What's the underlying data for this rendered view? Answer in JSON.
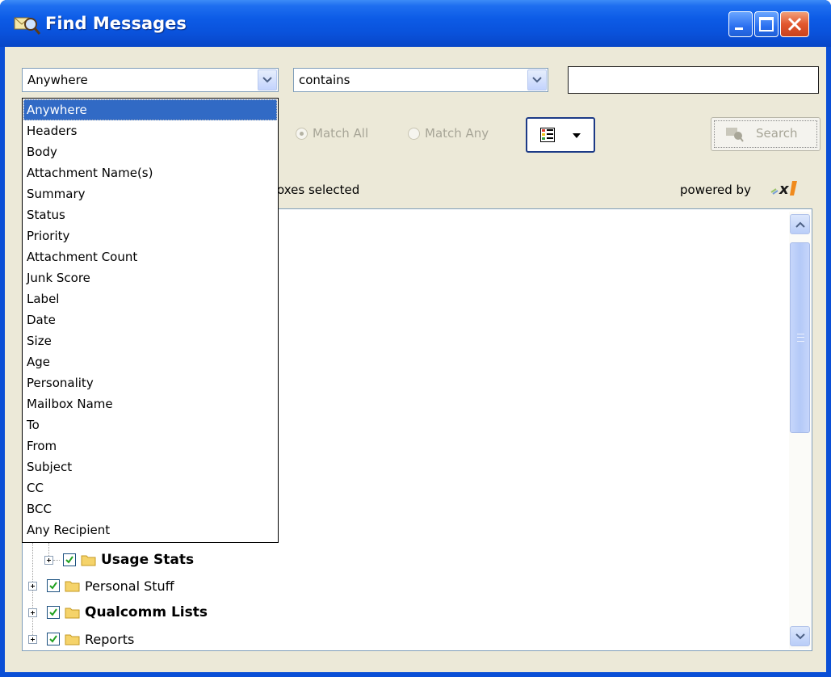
{
  "window": {
    "title": "Find Messages",
    "controls": [
      "minimize-icon",
      "maximize-icon",
      "close-icon"
    ]
  },
  "criteria": {
    "field_selected": "Anywhere",
    "operator_selected": "contains",
    "search_text": ""
  },
  "match": {
    "all_label": "Match All",
    "any_label": "Match Any",
    "selected": "all"
  },
  "search_button": "Search",
  "status_text": "oxes selected",
  "powered_by": "powered by",
  "field_options": [
    "Anywhere",
    "Headers",
    "Body",
    "Attachment Name(s)",
    "Summary",
    "Status",
    "Priority",
    "Attachment Count",
    "Junk Score",
    "Label",
    "Date",
    "Size",
    "Age",
    "Personality",
    "Mailbox Name",
    "To",
    "From",
    "Subject",
    "CC",
    "BCC",
    "Any Recipient"
  ],
  "mailbox_tree": [
    {
      "label": "Usage Stats",
      "checked": true,
      "bold": true,
      "level": 1
    },
    {
      "label": "Personal Stuff",
      "checked": true,
      "bold": false,
      "level": 0
    },
    {
      "label": "Qualcomm Lists",
      "checked": true,
      "bold": true,
      "level": 0
    },
    {
      "label": "Reports",
      "checked": true,
      "bold": false,
      "level": 0
    }
  ],
  "colors": {
    "titlebar": "#0a52db",
    "selection": "#316ac5",
    "dialog_bg": "#ece9d8"
  }
}
